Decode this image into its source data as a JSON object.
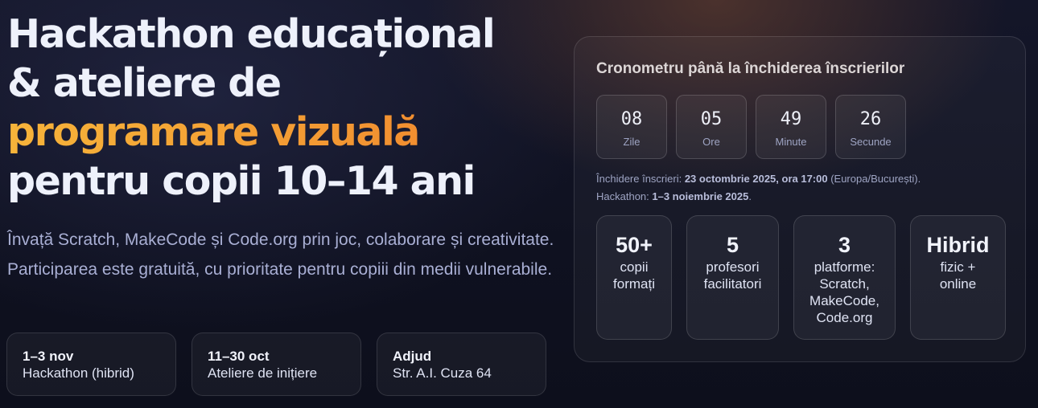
{
  "hero": {
    "title_line1": "Hackathon educațional",
    "title_line2": "& ateliere de",
    "title_accent": "programare vizuală",
    "title_line4": "pentru copii 10–14 ani",
    "subtitle": "Învață Scratch, MakeCode și Code.org prin joc, colaborare și creativitate. Participarea este gratuită, cu prioritate pentru copiii din medii vulnerabile."
  },
  "info_cards": [
    {
      "title": "1–3 nov",
      "text": "Hackathon (hibrid)"
    },
    {
      "title": "11–30 oct",
      "text": "Ateliere de inițiere"
    },
    {
      "title": "Adjud",
      "text": "Str. A.I. Cuza 64"
    }
  ],
  "countdown": {
    "title": "Cronometru până la închiderea înscrierilor",
    "units": [
      {
        "value": "08",
        "label": "Zile"
      },
      {
        "value": "05",
        "label": "Ore"
      },
      {
        "value": "49",
        "label": "Minute"
      },
      {
        "value": "26",
        "label": "Secunde"
      }
    ]
  },
  "deadline": {
    "line1_prefix": "Închidere înscrieri: ",
    "line1_bold": "23 octombrie 2025, ora 17:00",
    "line1_suffix": " (Europa/București).",
    "line2_prefix": "Hackathon: ",
    "line2_bold": "1–3 noiembrie 2025",
    "line2_suffix": "."
  },
  "stats": [
    {
      "number": "50+",
      "text": "copii formați"
    },
    {
      "number": "5",
      "text": "profesori facilitatori"
    },
    {
      "number": "3",
      "text": "platforme: Scratch, MakeCode, Code.org"
    },
    {
      "number": "Hibrid",
      "text": "fizic + online"
    }
  ],
  "colors": {
    "accent_start": "#f6b43a",
    "accent_end": "#ef7f2c",
    "background": "#0f1120"
  }
}
